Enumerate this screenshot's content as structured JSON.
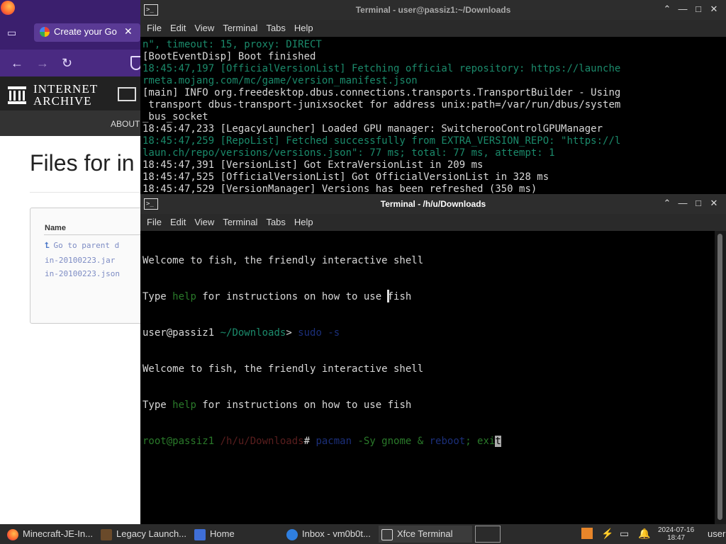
{
  "browser": {
    "tab_title": "Create your Go",
    "tab_close": "✕",
    "nav_back": "←",
    "nav_forward": "→",
    "nav_reload": "↻",
    "ia_line1": "INTERNET",
    "ia_line2": "ARCHIVE",
    "about": "ABOUT",
    "page_title": "Files for in",
    "files_header": "Name",
    "files": [
      "Go to parent d",
      "in-20100223.jar",
      "in-20100223.json"
    ]
  },
  "term_back": {
    "title": "Terminal - user@passiz1:~/Downloads",
    "menu": [
      "File",
      "Edit",
      "View",
      "Terminal",
      "Tabs",
      "Help"
    ],
    "lines": [
      {
        "t": "n\", timeout: 15, proxy: DIRECT",
        "c": "dimg"
      },
      {
        "t": "[BootEventDisp] Boot finished",
        "c": ""
      },
      {
        "t": "18:45:47,197 [OfficialVersionList] Fetching official repository: https://launche",
        "c": "dimg"
      },
      {
        "t": "rmeta.mojang.com/mc/game/version_manifest.json",
        "c": "dimg"
      },
      {
        "t": "[main] INFO org.freedesktop.dbus.connections.transports.TransportBuilder - Using",
        "c": ""
      },
      {
        "t": " transport dbus-transport-junixsocket for address unix:path=/var/run/dbus/system",
        "c": ""
      },
      {
        "t": "_bus_socket",
        "c": ""
      },
      {
        "t": "18:45:47,233 [LegacyLauncher] Loaded GPU manager: SwitcherooControlGPUManager",
        "c": ""
      },
      {
        "t": "18:45:47,259 [RepoList] Fetched successfully from EXTRA_VERSION_REPO: \"https://l",
        "c": "dimg"
      },
      {
        "t": "laun.ch/repo/versions/versions.json\": 77 ms; total: 77 ms, attempt: 1",
        "c": "dimg"
      },
      {
        "t": "18:45:47,391 [VersionList] Got ExtraVersionList in 209 ms",
        "c": ""
      },
      {
        "t": "18:45:47,525 [OfficialVersionList] Got OfficialVersionList in 328 ms",
        "c": ""
      },
      {
        "t": "18:45:47,529 [VersionManager] Versions has been refreshed (350 ms)",
        "c": ""
      }
    ]
  },
  "term_front": {
    "title": "Terminal - /h/u/Downloads",
    "menu": [
      "File",
      "Edit",
      "View",
      "Terminal",
      "Tabs",
      "Help"
    ],
    "welcome": "Welcome to fish, the friendly interactive shell",
    "type_pre": "Type ",
    "help_word": "help",
    "type_post": " for instructions on how to use fish",
    "user_prompt": "user@passiz1",
    "user_path": " ~/Downloads",
    "user_sym": "> ",
    "user_cmd": "sudo -s",
    "root_prompt": "root@passiz1",
    "root_path": " /h/u/Downloads",
    "root_sym": "# ",
    "root_cmd_a": "pacman",
    "root_cmd_b": " -Sy gnome & ",
    "root_cmd_c": "reboot",
    "root_cmd_d": "; exi",
    "root_cursor": "t"
  },
  "window_buttons": {
    "min": "⌃",
    "iconify": "—",
    "max": "□",
    "close": "✕"
  },
  "taskbar": {
    "items": [
      "Minecraft-JE-In...",
      "Legacy Launch...",
      "Home",
      "Inbox - vm0b0t...",
      "Xfce Terminal"
    ],
    "date": "2024-07-16",
    "time": "18:47",
    "user": "user"
  }
}
